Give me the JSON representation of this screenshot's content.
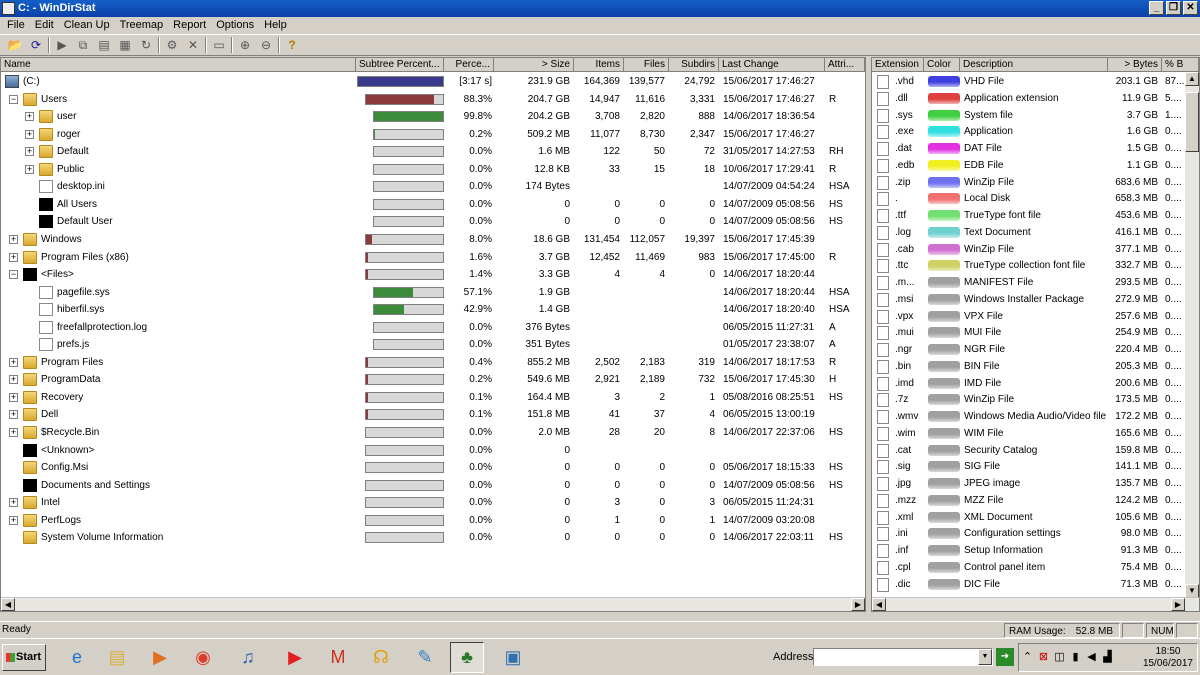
{
  "window": {
    "title": "C: - WinDirStat"
  },
  "menu": [
    "File",
    "Edit",
    "Clean Up",
    "Treemap",
    "Report",
    "Options",
    "Help"
  ],
  "dir_columns": [
    "Name",
    "Subtree Percent...",
    "Perce...",
    "> Size",
    "Items",
    "Files",
    "Subdirs",
    "Last Change",
    "Attri..."
  ],
  "dir_rows": [
    {
      "name": "(C:)",
      "indent": 0,
      "toggle": "",
      "icon": "drive",
      "pct": "[3:17 s]",
      "size": "231.9 GB",
      "items": "164,369",
      "files": "139,577",
      "subdirs": "24,792",
      "changed": "15/06/2017  17:46:27",
      "attr": "",
      "bar": 1.0,
      "bar_color": "#3a3a8c"
    },
    {
      "name": "Users",
      "indent": 1,
      "toggle": "−",
      "icon": "folder",
      "pct": "88.3%",
      "size": "204.7 GB",
      "items": "14,947",
      "files": "11,616",
      "subdirs": "3,331",
      "changed": "15/06/2017  17:46:27",
      "attr": "R",
      "bar": 0.883,
      "bar_color": "#8c3a3a"
    },
    {
      "name": "user",
      "indent": 2,
      "toggle": "+",
      "icon": "folder",
      "pct": "99.8%",
      "size": "204.2 GB",
      "items": "3,708",
      "files": "2,820",
      "subdirs": "888",
      "changed": "14/06/2017  18:36:54",
      "attr": "",
      "bar": 0.998,
      "bar_color": "#3c8c3c"
    },
    {
      "name": "roger",
      "indent": 2,
      "toggle": "+",
      "icon": "folder",
      "pct": "0.2%",
      "size": "509.2 MB",
      "items": "11,077",
      "files": "8,730",
      "subdirs": "2,347",
      "changed": "15/06/2017  17:46:27",
      "attr": "",
      "bar": 0.002,
      "bar_color": "#3c8c3c"
    },
    {
      "name": "Default",
      "indent": 2,
      "toggle": "+",
      "icon": "folder",
      "pct": "0.0%",
      "size": "1.6 MB",
      "items": "122",
      "files": "50",
      "subdirs": "72",
      "changed": "31/05/2017  14:27:53",
      "attr": "RH",
      "bar": 0,
      "bar_color": "#3c8c3c"
    },
    {
      "name": "Public",
      "indent": 2,
      "toggle": "+",
      "icon": "folder",
      "pct": "0.0%",
      "size": "12.8 KB",
      "items": "33",
      "files": "15",
      "subdirs": "18",
      "changed": "10/06/2017  17:29:41",
      "attr": "R",
      "bar": 0,
      "bar_color": "#3c8c3c"
    },
    {
      "name": "desktop.ini",
      "indent": 2,
      "toggle": "",
      "icon": "doc",
      "pct": "0.0%",
      "size": "174 Bytes",
      "items": "",
      "files": "",
      "subdirs": "",
      "changed": "14/07/2009  04:54:24",
      "attr": "HSA",
      "bar": 0,
      "bar_color": "#3c8c3c"
    },
    {
      "name": "All Users",
      "indent": 2,
      "toggle": "",
      "icon": "blk",
      "pct": "0.0%",
      "size": "0",
      "items": "0",
      "files": "0",
      "subdirs": "0",
      "changed": "14/07/2009  05:08:56",
      "attr": "HS",
      "bar": 0,
      "bar_color": "#3c8c3c"
    },
    {
      "name": "Default User",
      "indent": 2,
      "toggle": "",
      "icon": "blk",
      "pct": "0.0%",
      "size": "0",
      "items": "0",
      "files": "0",
      "subdirs": "0",
      "changed": "14/07/2009  05:08:56",
      "attr": "HS",
      "bar": 0,
      "bar_color": "#3c8c3c"
    },
    {
      "name": "Windows",
      "indent": 1,
      "toggle": "+",
      "icon": "folder",
      "pct": "8.0%",
      "size": "18.6 GB",
      "items": "131,454",
      "files": "112,057",
      "subdirs": "19,397",
      "changed": "15/06/2017  17:45:39",
      "attr": "",
      "bar": 0.08,
      "bar_color": "#8c3a3a"
    },
    {
      "name": "Program Files (x86)",
      "indent": 1,
      "toggle": "+",
      "icon": "folder",
      "pct": "1.6%",
      "size": "3.7 GB",
      "items": "12,452",
      "files": "11,469",
      "subdirs": "983",
      "changed": "15/06/2017  17:45:00",
      "attr": "R",
      "bar": 0.016,
      "bar_color": "#8c3a3a"
    },
    {
      "name": "<Files>",
      "indent": 1,
      "toggle": "−",
      "icon": "blk",
      "pct": "1.4%",
      "size": "3.3 GB",
      "items": "4",
      "files": "4",
      "subdirs": "0",
      "changed": "14/06/2017  18:20:44",
      "attr": "",
      "bar": 0.014,
      "bar_color": "#8c3a3a"
    },
    {
      "name": "pagefile.sys",
      "indent": 2,
      "toggle": "",
      "icon": "doc",
      "pct": "57.1%",
      "size": "1.9 GB",
      "items": "",
      "files": "",
      "subdirs": "",
      "changed": "14/06/2017  18:20:44",
      "attr": "HSA",
      "bar": 0.571,
      "bar_color": "#3c8c3c"
    },
    {
      "name": "hiberfil.sys",
      "indent": 2,
      "toggle": "",
      "icon": "doc",
      "pct": "42.9%",
      "size": "1.4 GB",
      "items": "",
      "files": "",
      "subdirs": "",
      "changed": "14/06/2017  18:20:40",
      "attr": "HSA",
      "bar": 0.429,
      "bar_color": "#3c8c3c"
    },
    {
      "name": "freefallprotection.log",
      "indent": 2,
      "toggle": "",
      "icon": "doc",
      "pct": "0.0%",
      "size": "376 Bytes",
      "items": "",
      "files": "",
      "subdirs": "",
      "changed": "06/05/2015  11:27:31",
      "attr": "A",
      "bar": 0,
      "bar_color": "#3c8c3c"
    },
    {
      "name": "prefs.js",
      "indent": 2,
      "toggle": "",
      "icon": "doc",
      "pct": "0.0%",
      "size": "351 Bytes",
      "items": "",
      "files": "",
      "subdirs": "",
      "changed": "01/05/2017  23:38:07",
      "attr": "A",
      "bar": 0,
      "bar_color": "#3c8c3c"
    },
    {
      "name": "Program Files",
      "indent": 1,
      "toggle": "+",
      "icon": "folder",
      "pct": "0.4%",
      "size": "855.2 MB",
      "items": "2,502",
      "files": "2,183",
      "subdirs": "319",
      "changed": "14/06/2017  18:17:53",
      "attr": "R",
      "bar": 0.004,
      "bar_color": "#8c3a3a"
    },
    {
      "name": "ProgramData",
      "indent": 1,
      "toggle": "+",
      "icon": "folder",
      "pct": "0.2%",
      "size": "549.6 MB",
      "items": "2,921",
      "files": "2,189",
      "subdirs": "732",
      "changed": "15/06/2017  17:45:30",
      "attr": "H",
      "bar": 0.002,
      "bar_color": "#8c3a3a"
    },
    {
      "name": "Recovery",
      "indent": 1,
      "toggle": "+",
      "icon": "folder",
      "pct": "0.1%",
      "size": "164.4 MB",
      "items": "3",
      "files": "2",
      "subdirs": "1",
      "changed": "05/08/2016  08:25:51",
      "attr": "HS",
      "bar": 0.001,
      "bar_color": "#8c3a3a"
    },
    {
      "name": "Dell",
      "indent": 1,
      "toggle": "+",
      "icon": "folder",
      "pct": "0.1%",
      "size": "151.8 MB",
      "items": "41",
      "files": "37",
      "subdirs": "4",
      "changed": "06/05/2015  13:00:19",
      "attr": "",
      "bar": 0.001,
      "bar_color": "#8c3a3a"
    },
    {
      "name": "$Recycle.Bin",
      "indent": 1,
      "toggle": "+",
      "icon": "folder",
      "pct": "0.0%",
      "size": "2.0 MB",
      "items": "28",
      "files": "20",
      "subdirs": "8",
      "changed": "14/06/2017  22:37:06",
      "attr": "HS",
      "bar": 0,
      "bar_color": "#8c3a3a"
    },
    {
      "name": "<Unknown>",
      "indent": 1,
      "toggle": "",
      "icon": "blk",
      "pct": "0.0%",
      "size": "0",
      "items": "",
      "files": "",
      "subdirs": "",
      "changed": "",
      "attr": "",
      "bar": 0,
      "bar_color": "#8c3a3a"
    },
    {
      "name": "Config.Msi",
      "indent": 1,
      "toggle": "",
      "icon": "folder",
      "pct": "0.0%",
      "size": "0",
      "items": "0",
      "files": "0",
      "subdirs": "0",
      "changed": "05/06/2017  18:15:33",
      "attr": "HS",
      "bar": 0,
      "bar_color": "#8c3a3a"
    },
    {
      "name": "Documents and Settings",
      "indent": 1,
      "toggle": "",
      "icon": "blk",
      "pct": "0.0%",
      "size": "0",
      "items": "0",
      "files": "0",
      "subdirs": "0",
      "changed": "14/07/2009  05:08:56",
      "attr": "HS",
      "bar": 0,
      "bar_color": "#8c3a3a"
    },
    {
      "name": "Intel",
      "indent": 1,
      "toggle": "+",
      "icon": "folder",
      "pct": "0.0%",
      "size": "0",
      "items": "3",
      "files": "0",
      "subdirs": "3",
      "changed": "06/05/2015  11:24:31",
      "attr": "",
      "bar": 0,
      "bar_color": "#8c3a3a"
    },
    {
      "name": "PerfLogs",
      "indent": 1,
      "toggle": "+",
      "icon": "folder",
      "pct": "0.0%",
      "size": "0",
      "items": "1",
      "files": "0",
      "subdirs": "1",
      "changed": "14/07/2009  03:20:08",
      "attr": "",
      "bar": 0,
      "bar_color": "#8c3a3a"
    },
    {
      "name": "System Volume Information",
      "indent": 1,
      "toggle": "",
      "icon": "folder",
      "pct": "0.0%",
      "size": "0",
      "items": "0",
      "files": "0",
      "subdirs": "0",
      "changed": "14/06/2017  22:03:11",
      "attr": "HS",
      "bar": 0,
      "bar_color": "#8c3a3a"
    }
  ],
  "ext_columns": [
    "Extension",
    "Color",
    "Description",
    "> Bytes",
    "% B"
  ],
  "ext_rows": [
    {
      "ext": ".vhd",
      "color": "#4040e0",
      "desc": "VHD File",
      "bytes": "203.1 GB",
      "pct": "87..."
    },
    {
      "ext": ".dll",
      "color": "#e04040",
      "desc": "Application extension",
      "bytes": "11.9 GB",
      "pct": "5...."
    },
    {
      "ext": ".sys",
      "color": "#40d040",
      "desc": "System file",
      "bytes": "3.7 GB",
      "pct": "1...."
    },
    {
      "ext": ".exe",
      "color": "#30e0e0",
      "desc": "Application",
      "bytes": "1.6 GB",
      "pct": "0...."
    },
    {
      "ext": ".dat",
      "color": "#e030e0",
      "desc": "DAT File",
      "bytes": "1.5 GB",
      "pct": "0...."
    },
    {
      "ext": ".edb",
      "color": "#f0f020",
      "desc": "EDB File",
      "bytes": "1.1 GB",
      "pct": "0...."
    },
    {
      "ext": ".zip",
      "color": "#7070f0",
      "desc": "WinZip File",
      "bytes": "683.6 MB",
      "pct": "0...."
    },
    {
      "ext": ".",
      "color": "#f07070",
      "desc": "Local Disk",
      "bytes": "658.3 MB",
      "pct": "0...."
    },
    {
      "ext": ".ttf",
      "color": "#70e070",
      "desc": "TrueType font file",
      "bytes": "453.6 MB",
      "pct": "0...."
    },
    {
      "ext": ".log",
      "color": "#70d0d0",
      "desc": "Text Document",
      "bytes": "416.1 MB",
      "pct": "0...."
    },
    {
      "ext": ".cab",
      "color": "#d070d0",
      "desc": "WinZip File",
      "bytes": "377.1 MB",
      "pct": "0...."
    },
    {
      "ext": ".ttc",
      "color": "#d0d060",
      "desc": "TrueType collection font file",
      "bytes": "332.7 MB",
      "pct": "0...."
    },
    {
      "ext": ".m...",
      "color": "#a0a0a0",
      "desc": "MANIFEST File",
      "bytes": "293.5 MB",
      "pct": "0...."
    },
    {
      "ext": ".msi",
      "color": "#a0a0a0",
      "desc": "Windows Installer Package",
      "bytes": "272.9 MB",
      "pct": "0...."
    },
    {
      "ext": ".vpx",
      "color": "#a0a0a0",
      "desc": "VPX File",
      "bytes": "257.6 MB",
      "pct": "0...."
    },
    {
      "ext": ".mui",
      "color": "#a0a0a0",
      "desc": "MUI File",
      "bytes": "254.9 MB",
      "pct": "0...."
    },
    {
      "ext": ".ngr",
      "color": "#a0a0a0",
      "desc": "NGR File",
      "bytes": "220.4 MB",
      "pct": "0...."
    },
    {
      "ext": ".bin",
      "color": "#a0a0a0",
      "desc": "BIN File",
      "bytes": "205.3 MB",
      "pct": "0...."
    },
    {
      "ext": ".imd",
      "color": "#a0a0a0",
      "desc": "IMD File",
      "bytes": "200.6 MB",
      "pct": "0...."
    },
    {
      "ext": ".7z",
      "color": "#a0a0a0",
      "desc": "WinZip File",
      "bytes": "173.5 MB",
      "pct": "0...."
    },
    {
      "ext": ".wmv",
      "color": "#a0a0a0",
      "desc": "Windows Media Audio/Video file",
      "bytes": "172.2 MB",
      "pct": "0...."
    },
    {
      "ext": ".wim",
      "color": "#a0a0a0",
      "desc": "WIM File",
      "bytes": "165.6 MB",
      "pct": "0...."
    },
    {
      "ext": ".cat",
      "color": "#a0a0a0",
      "desc": "Security Catalog",
      "bytes": "159.8 MB",
      "pct": "0...."
    },
    {
      "ext": ".sig",
      "color": "#a0a0a0",
      "desc": "SIG File",
      "bytes": "141.1 MB",
      "pct": "0...."
    },
    {
      "ext": ".jpg",
      "color": "#a0a0a0",
      "desc": "JPEG image",
      "bytes": "135.7 MB",
      "pct": "0...."
    },
    {
      "ext": ".mzz",
      "color": "#a0a0a0",
      "desc": "MZZ File",
      "bytes": "124.2 MB",
      "pct": "0...."
    },
    {
      "ext": ".xml",
      "color": "#a0a0a0",
      "desc": "XML Document",
      "bytes": "105.6 MB",
      "pct": "0...."
    },
    {
      "ext": ".ini",
      "color": "#a0a0a0",
      "desc": "Configuration settings",
      "bytes": "98.0 MB",
      "pct": "0...."
    },
    {
      "ext": ".inf",
      "color": "#a0a0a0",
      "desc": "Setup Information",
      "bytes": "91.3 MB",
      "pct": "0...."
    },
    {
      "ext": ".cpl",
      "color": "#a0a0a0",
      "desc": "Control panel item",
      "bytes": "75.4 MB",
      "pct": "0...."
    },
    {
      "ext": ".dic",
      "color": "#a0a0a0",
      "desc": "DIC File",
      "bytes": "71.3 MB",
      "pct": "0...."
    }
  ],
  "status": {
    "left": "Ready",
    "ram_label": "RAM Usage:",
    "ram_value": "52.8 MB",
    "num": "NUM"
  },
  "taskbar": {
    "start": "Start",
    "address_label": "Address",
    "address_value": "",
    "time": "18:50",
    "date": "15/06/2017"
  },
  "taskbar_apps": [
    {
      "name": "internet-explorer",
      "glyph": "e",
      "color": "#1e73d8"
    },
    {
      "name": "file-explorer",
      "glyph": "▤",
      "color": "#d8b040"
    },
    {
      "name": "media-player",
      "glyph": "▶",
      "color": "#e07020"
    },
    {
      "name": "chrome",
      "glyph": "◉",
      "color": "#dd3b2c"
    },
    {
      "name": "itunes",
      "glyph": "♫",
      "color": "#3060a0"
    },
    {
      "name": "youtube",
      "glyph": "▶",
      "color": "#e02020"
    },
    {
      "name": "gmail",
      "glyph": "M",
      "color": "#d03020"
    },
    {
      "name": "audio-app",
      "glyph": "☊",
      "color": "#e0a000"
    },
    {
      "name": "paint",
      "glyph": "✎",
      "color": "#3080c0"
    },
    {
      "name": "windirstat",
      "glyph": "♣",
      "color": "#2a7a2a",
      "pressed": true
    },
    {
      "name": "control-panel",
      "glyph": "▣",
      "color": "#3070b0"
    }
  ]
}
